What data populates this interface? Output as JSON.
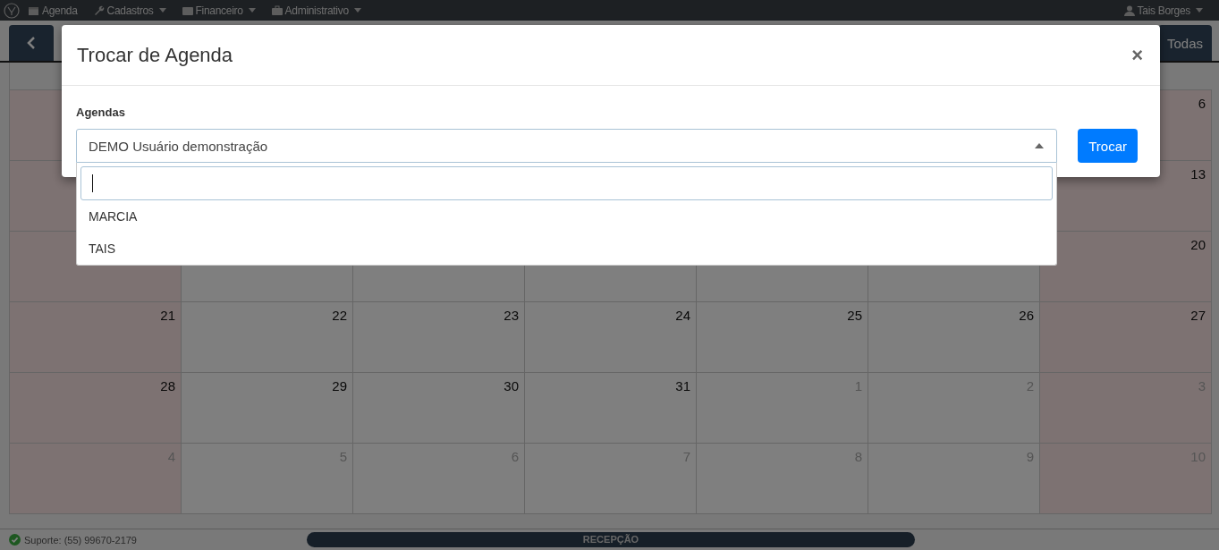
{
  "navbar": {
    "menu": [
      {
        "label": "Agenda",
        "kind": "link"
      },
      {
        "label": "Cadastros",
        "kind": "dropdown"
      },
      {
        "label": "Financeiro",
        "kind": "dropdown"
      },
      {
        "label": "Administrativo",
        "kind": "dropdown"
      }
    ],
    "user": {
      "label": "Tais Borges",
      "kind": "dropdown"
    }
  },
  "toolbar": {
    "filter_button": "Todas"
  },
  "calendar": {
    "weeks": [
      [
        {
          "day": "6",
          "other_month": false
        }
      ],
      [
        {
          "day": "13",
          "other_month": false
        }
      ],
      [
        {
          "day": "20",
          "other_month": false
        }
      ],
      [
        {
          "day": "21",
          "other_month": false
        },
        {
          "day": "22",
          "other_month": false
        },
        {
          "day": "23",
          "other_month": false
        },
        {
          "day": "24",
          "other_month": false
        },
        {
          "day": "25",
          "other_month": false
        },
        {
          "day": "26",
          "other_month": false
        },
        {
          "day": "27",
          "other_month": false
        }
      ],
      [
        {
          "day": "28",
          "other_month": false
        },
        {
          "day": "29",
          "other_month": false
        },
        {
          "day": "30",
          "other_month": false
        },
        {
          "day": "31",
          "other_month": false
        },
        {
          "day": "1",
          "other_month": true
        },
        {
          "day": "2",
          "other_month": true
        },
        {
          "day": "3",
          "other_month": true
        }
      ],
      [
        {
          "day": "4",
          "other_month": true
        },
        {
          "day": "5",
          "other_month": true
        },
        {
          "day": "6",
          "other_month": true
        },
        {
          "day": "7",
          "other_month": true
        },
        {
          "day": "8",
          "other_month": true
        },
        {
          "day": "9",
          "other_month": true
        },
        {
          "day": "10",
          "other_month": true
        }
      ]
    ]
  },
  "footer": {
    "support": "Suporte: (55) 99670-2179",
    "section": "RECEPÇÃO"
  },
  "modal": {
    "title": "Trocar de Agenda",
    "close": "×",
    "field_label": "Agendas",
    "select": {
      "value": "DEMO Usuário demonstração",
      "expanded": true,
      "options": [
        {
          "label": "MARCIA",
          "selected": false
        },
        {
          "label": "TAIS",
          "selected": false
        }
      ]
    },
    "submit": "Trocar"
  }
}
